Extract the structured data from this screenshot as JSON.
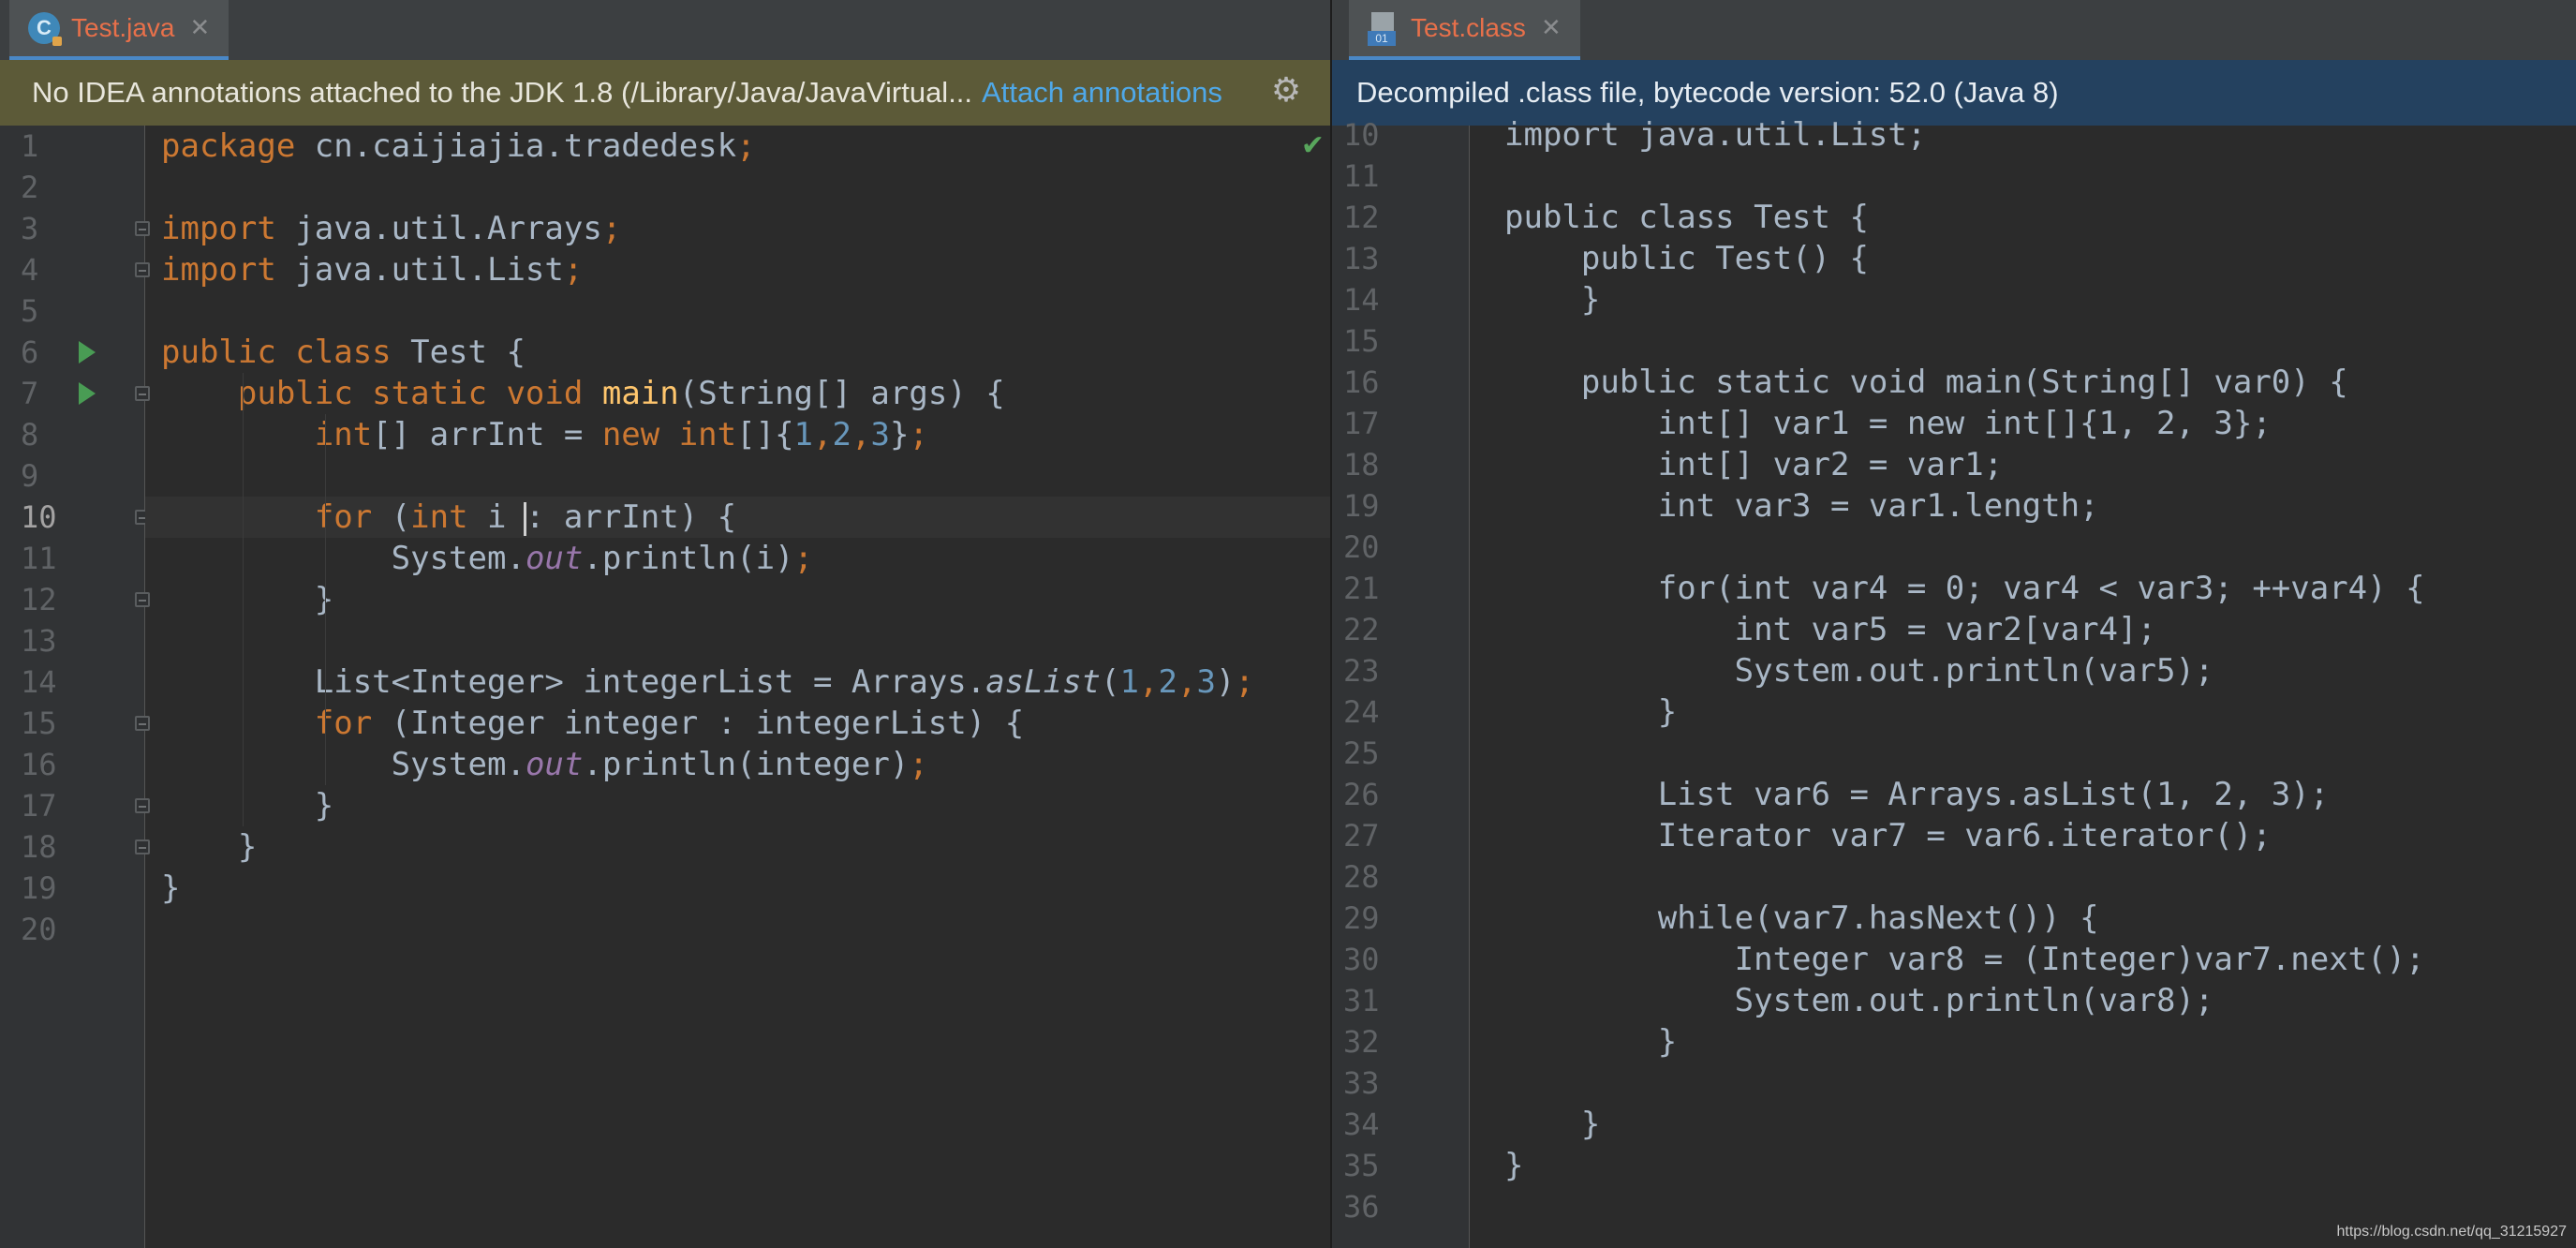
{
  "left_pane": {
    "tab": {
      "icon": "java-class-c-icon",
      "label": "Test.java",
      "close": "✕"
    },
    "banner": {
      "text": "No IDEA annotations attached to the JDK 1.8 (/Library/Java/JavaVirtual...",
      "link": "Attach annotations",
      "settings_icon": "gear-icon"
    },
    "status_check_icon": "green-check-icon",
    "current_line": 10,
    "line_numbers": [
      "1",
      "2",
      "3",
      "4",
      "5",
      "6",
      "7",
      "8",
      "9",
      "10",
      "11",
      "12",
      "13",
      "14",
      "15",
      "16",
      "17",
      "18",
      "19",
      "20"
    ],
    "code_lines": [
      [
        {
          "t": "package",
          "c": "kw"
        },
        {
          "t": " cn.caijiajia.tradedesk"
        },
        {
          "t": ";",
          "c": "kw"
        }
      ],
      [],
      [
        {
          "t": "import",
          "c": "kw"
        },
        {
          "t": " java.util.Arrays"
        },
        {
          "t": ";",
          "c": "kw"
        }
      ],
      [
        {
          "t": "import",
          "c": "kw"
        },
        {
          "t": " java.util.List"
        },
        {
          "t": ";",
          "c": "kw"
        }
      ],
      [],
      [
        {
          "t": "public class",
          "c": "kw"
        },
        {
          "t": " Test {"
        }
      ],
      [
        {
          "t": "    "
        },
        {
          "t": "public static void",
          "c": "kw"
        },
        {
          "t": " "
        },
        {
          "t": "main",
          "c": "fn"
        },
        {
          "t": "(String[] args) {"
        }
      ],
      [
        {
          "t": "        "
        },
        {
          "t": "int",
          "c": "kw"
        },
        {
          "t": "[] arrInt = "
        },
        {
          "t": "new int",
          "c": "kw"
        },
        {
          "t": "[]{"
        },
        {
          "t": "1",
          "c": "num"
        },
        {
          "t": ",",
          "c": "kw"
        },
        {
          "t": "2",
          "c": "num"
        },
        {
          "t": ",",
          "c": "kw"
        },
        {
          "t": "3",
          "c": "num"
        },
        {
          "t": "}"
        },
        {
          "t": ";",
          "c": "kw"
        }
      ],
      [],
      [
        {
          "t": "        "
        },
        {
          "t": "for",
          "c": "kw"
        },
        {
          "t": " ("
        },
        {
          "t": "int",
          "c": "kw"
        },
        {
          "t": " i "
        },
        {
          "t": "",
          "c": "caret"
        },
        {
          "t": ": arrInt) {"
        }
      ],
      [
        {
          "t": "            System."
        },
        {
          "t": "out",
          "c": "st"
        },
        {
          "t": ".println(i)"
        },
        {
          "t": ";",
          "c": "kw"
        }
      ],
      [
        {
          "t": "        }"
        }
      ],
      [],
      [
        {
          "t": "        List<Integer> integerList = Arrays."
        },
        {
          "t": "asList",
          "c": "it"
        },
        {
          "t": "("
        },
        {
          "t": "1",
          "c": "num"
        },
        {
          "t": ",",
          "c": "kw"
        },
        {
          "t": "2",
          "c": "num"
        },
        {
          "t": ",",
          "c": "kw"
        },
        {
          "t": "3",
          "c": "num"
        },
        {
          "t": ")"
        },
        {
          "t": ";",
          "c": "kw"
        }
      ],
      [
        {
          "t": "        "
        },
        {
          "t": "for",
          "c": "kw"
        },
        {
          "t": " (Integer integer : integerList) {"
        }
      ],
      [
        {
          "t": "            System."
        },
        {
          "t": "out",
          "c": "st"
        },
        {
          "t": ".println(integer)"
        },
        {
          "t": ";",
          "c": "kw"
        }
      ],
      [
        {
          "t": "        }"
        }
      ],
      [
        {
          "t": "    }"
        }
      ],
      [
        {
          "t": "}"
        }
      ],
      []
    ]
  },
  "right_pane": {
    "tab": {
      "icon": "class-file-icon",
      "label": "Test.class",
      "close": "✕"
    },
    "banner": {
      "text": "Decompiled .class file, bytecode version: 52.0 (Java 8)"
    },
    "line_numbers": [
      "10",
      "11",
      "12",
      "13",
      "14",
      "15",
      "16",
      "17",
      "18",
      "19",
      "20",
      "21",
      "22",
      "23",
      "24",
      "25",
      "26",
      "27",
      "28",
      "29",
      "30",
      "31",
      "32",
      "33",
      "34",
      "35",
      "36"
    ],
    "code_lines": [
      "import java.util.List;",
      "",
      "public class Test {",
      "    public Test() {",
      "    }",
      "",
      "    public static void main(String[] var0) {",
      "        int[] var1 = new int[]{1, 2, 3};",
      "        int[] var2 = var1;",
      "        int var3 = var1.length;",
      "",
      "        for(int var4 = 0; var4 < var3; ++var4) {",
      "            int var5 = var2[var4];",
      "            System.out.println(var5);",
      "        }",
      "",
      "        List var6 = Arrays.asList(1, 2, 3);",
      "        Iterator var7 = var6.iterator();",
      "",
      "        while(var7.hasNext()) {",
      "            Integer var8 = (Integer)var7.next();",
      "            System.out.println(var8);",
      "        }",
      "",
      "    }",
      "}",
      ""
    ]
  },
  "watermark": "https://blog.csdn.net/qq_31215927"
}
